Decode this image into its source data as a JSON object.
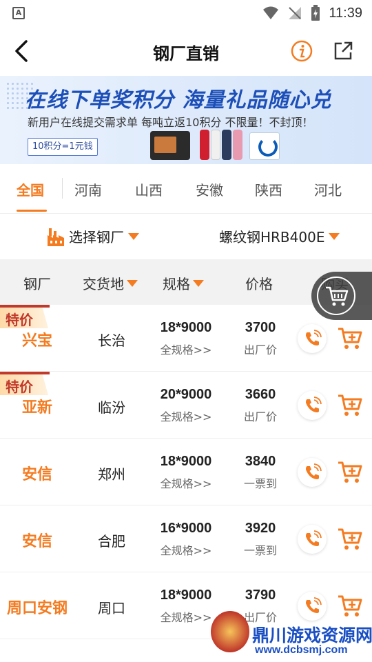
{
  "status": {
    "left_icon": "A",
    "time": "11:39"
  },
  "nav": {
    "title": "钢厂直销"
  },
  "banner": {
    "headline": "在线下单奖积分  海量礼品随心兑",
    "sub": "新用户在线提交需求单  每吨立返10积分  不限量！不封顶！",
    "tag": "10积分=1元钱"
  },
  "tabs": [
    {
      "label": "全国",
      "active": true
    },
    {
      "label": "河南"
    },
    {
      "label": "山西"
    },
    {
      "label": "安徽"
    },
    {
      "label": "陕西"
    },
    {
      "label": "河北"
    }
  ],
  "filters": {
    "mill": "选择钢厂",
    "product": "螺纹钢HRB400E"
  },
  "table": {
    "headers": {
      "mill": "钢厂",
      "place": "交货地",
      "spec": "规格",
      "price": "价格",
      "buy": "购买"
    },
    "special_label": "特价",
    "rows": [
      {
        "mill": "兴宝",
        "place": "长治",
        "spec": "18*9000",
        "spec_sub": "全规格>>",
        "price": "3700",
        "price_sub": "出厂价"
      },
      {
        "mill": "亚新",
        "place": "临汾",
        "spec": "20*9000",
        "spec_sub": "全规格>>",
        "price": "3660",
        "price_sub": "出厂价"
      },
      {
        "mill": "安信",
        "place": "郑州",
        "spec": "18*9000",
        "spec_sub": "全规格>>",
        "price": "3840",
        "price_sub": "一票到"
      },
      {
        "mill": "安信",
        "place": "合肥",
        "spec": "16*9000",
        "spec_sub": "全规格>>",
        "price": "3920",
        "price_sub": "一票到"
      },
      {
        "mill": "周口安钢",
        "place": "周口",
        "spec": "18*9000",
        "spec_sub": "全规格>>",
        "price": "3790",
        "price_sub": "出厂价"
      }
    ]
  },
  "watermark": {
    "title": "鼎川游戏资源网",
    "url": "www.dcbsmj.com"
  },
  "colors": {
    "accent": "#f47b20",
    "banner_blue": "#1d4fb8",
    "special_red": "#c0392b"
  }
}
